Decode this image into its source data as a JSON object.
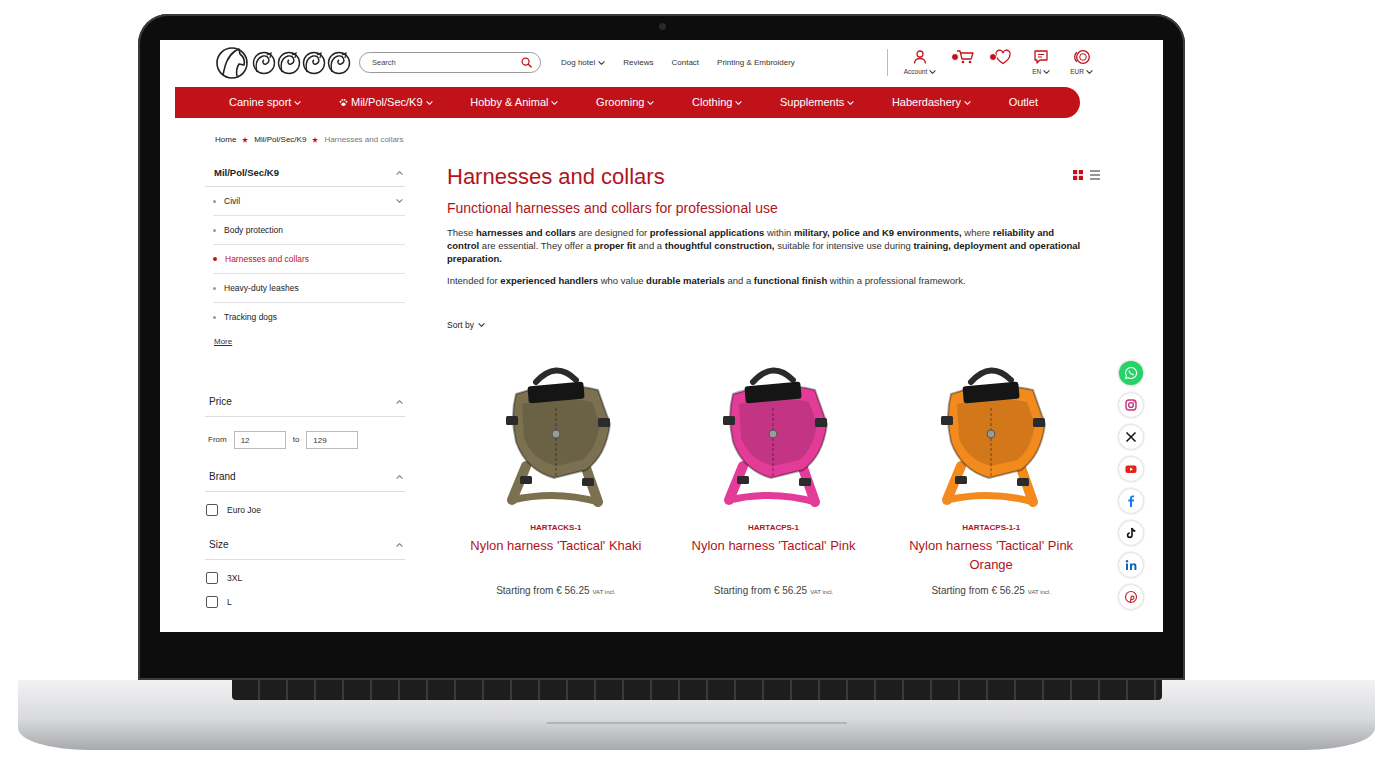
{
  "header": {
    "search": {
      "placeholder": "Search"
    },
    "links": [
      {
        "label": "Dog hotel",
        "dropdown": true
      },
      {
        "label": "Reviews",
        "dropdown": false
      },
      {
        "label": "Contact",
        "dropdown": false
      },
      {
        "label": "Printing & Embroidery",
        "dropdown": false
      }
    ],
    "tools": [
      {
        "kind": "account",
        "label": "Account",
        "dropdown": true,
        "badge": false
      },
      {
        "kind": "cart",
        "dropdown": false,
        "badge": true
      },
      {
        "kind": "wishlist",
        "dropdown": false,
        "badge": true
      },
      {
        "kind": "language",
        "label": "EN",
        "dropdown": true,
        "badge": false
      },
      {
        "kind": "currency",
        "label": "EUR",
        "dropdown": true,
        "badge": false
      }
    ]
  },
  "nav": [
    {
      "label": "Canine sport",
      "dropdown": true,
      "kind": "plain"
    },
    {
      "label": "Mil/Pol/Sec/K9",
      "dropdown": true,
      "kind": "icon"
    },
    {
      "label": "Hobby & Animal",
      "dropdown": true,
      "kind": "plain"
    },
    {
      "label": "Grooming",
      "dropdown": true,
      "kind": "plain"
    },
    {
      "label": "Clothing",
      "dropdown": true,
      "kind": "plain"
    },
    {
      "label": "Supplements",
      "dropdown": true,
      "kind": "plain"
    },
    {
      "label": "Haberdashery",
      "dropdown": true,
      "kind": "plain"
    },
    {
      "label": "Outlet",
      "dropdown": false,
      "kind": "plain"
    }
  ],
  "breadcrumb": [
    {
      "label": "Home",
      "current": false
    },
    {
      "label": "Mil/Pol/Sec/K9",
      "current": false
    },
    {
      "label": "Harnesses and collars",
      "current": true
    }
  ],
  "sidebar": {
    "title": "Mil/Pol/Sec/K9",
    "expanded": true,
    "items": [
      {
        "label": "Civil",
        "selected": false,
        "expanded": false
      },
      {
        "label": "Body protection",
        "selected": false
      },
      {
        "label": "Harnesses and collars",
        "selected": true
      },
      {
        "label": "Heavy-duty leashes",
        "selected": false
      },
      {
        "label": "Tracking dogs",
        "selected": false
      }
    ],
    "more": "More"
  },
  "filters": {
    "price": {
      "title": "Price",
      "expanded": true,
      "from_label": "From",
      "from": "12",
      "to_label": "to",
      "to": "129"
    },
    "brand": {
      "title": "Brand",
      "expanded": true,
      "options": [
        {
          "label": "Euro Joe",
          "checked": false
        }
      ]
    },
    "size": {
      "title": "Size",
      "expanded": true,
      "options": [
        {
          "label": "3XL",
          "checked": false
        },
        {
          "label": "L",
          "checked": false
        }
      ]
    }
  },
  "page": {
    "title": "Harnesses and collars",
    "subtitle": "Functional harnesses and collars for professional use",
    "paragraphs": [
      [
        {
          "text": "These ",
          "bold": false
        },
        {
          "text": "harnesses and collars",
          "bold": true
        },
        {
          "text": " are designed for ",
          "bold": false
        },
        {
          "text": "professional applications",
          "bold": true
        },
        {
          "text": " within ",
          "bold": false
        },
        {
          "text": "military, police and K9 environments,",
          "bold": true
        },
        {
          "text": " where ",
          "bold": false
        },
        {
          "text": "reliability and control",
          "bold": true
        },
        {
          "text": " are essential. They offer a ",
          "bold": false
        },
        {
          "text": "proper fit",
          "bold": true
        },
        {
          "text": " and a ",
          "bold": false
        },
        {
          "text": "thoughtful construction,",
          "bold": true
        },
        {
          "text": " suitable for intensive use during ",
          "bold": false
        },
        {
          "text": "training, deployment and operational preparation.",
          "bold": true
        }
      ],
      [
        {
          "text": "Intended for ",
          "bold": false
        },
        {
          "text": "experienced handlers",
          "bold": true
        },
        {
          "text": " who value ",
          "bold": false
        },
        {
          "text": "durable materials",
          "bold": true
        },
        {
          "text": " and a ",
          "bold": false
        },
        {
          "text": "functional finish",
          "bold": true
        },
        {
          "text": " within a professional framework.",
          "bold": false
        }
      ]
    ],
    "sort": "Sort by",
    "views": [
      {
        "kind": "grid",
        "selected": true
      },
      {
        "kind": "list",
        "selected": false
      }
    ]
  },
  "products": [
    {
      "code": "HARTACKS-1",
      "name": "Nylon harness 'Tactical' Khaki",
      "price": "Starting from € 56.25",
      "tax": "VAT incl.",
      "color": "#7b7150"
    },
    {
      "code": "HARTACPS-1",
      "name": "Nylon harness 'Tactical' Pink",
      "price": "Starting from € 56.25",
      "tax": "VAT incl.",
      "color": "#e23c98"
    },
    {
      "code": "HARTACPS-1-1",
      "name": "Nylon harness 'Tactical' Pink Orange",
      "price": "Starting from € 56.25",
      "tax": "VAT incl.",
      "color": "#f28a1e"
    }
  ],
  "social": [
    {
      "kind": "whatsapp"
    },
    {
      "kind": "instagram"
    },
    {
      "kind": "x"
    },
    {
      "kind": "youtube"
    },
    {
      "kind": "facebook"
    },
    {
      "kind": "tiktok"
    },
    {
      "kind": "linkedin"
    },
    {
      "kind": "pinterest"
    }
  ]
}
